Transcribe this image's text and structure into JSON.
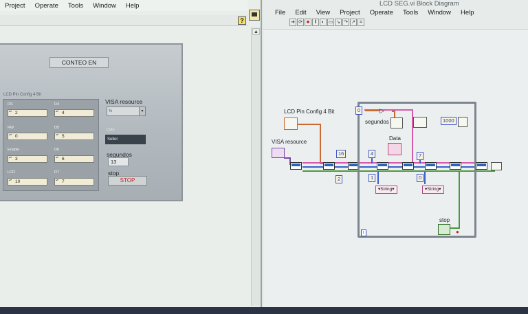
{
  "front_panel": {
    "menu": [
      "Project",
      "Operate",
      "Tools",
      "Window",
      "Help"
    ],
    "help_button": "?",
    "title_box": "CONTEO EN",
    "cluster_label": "LCD Pin Config 4 Bit",
    "cluster_fields": [
      {
        "label": "RS",
        "value": "2"
      },
      {
        "label": "D4",
        "value": "4"
      },
      {
        "label": "RW",
        "value": "0"
      },
      {
        "label": "D5",
        "value": "5"
      },
      {
        "label": "Enable",
        "value": "3"
      },
      {
        "label": "D6",
        "value": "6"
      },
      {
        "label": "LCD",
        "value": "10"
      },
      {
        "label": "D7",
        "value": "7"
      }
    ],
    "visa_label": "VISA resource",
    "visa_value": "%",
    "data_label": "Data",
    "data_value": "Sellor",
    "segundos_label": "segundos",
    "segundos_value": "13",
    "stop_label": "stop",
    "stop_button": "STOP"
  },
  "block_diagram": {
    "title": "LCD SEG.vi Block Diagram",
    "menu": [
      "File",
      "Edit",
      "View",
      "Project",
      "Operate",
      "Tools",
      "Window",
      "Help"
    ],
    "labels": {
      "lcd_pin": "LCD Pin Config 4 Bit",
      "visa": "VISA resource",
      "segundos": "segundos",
      "data": "Data",
      "stop": "stop"
    },
    "constants": {
      "c16": "16",
      "c2": "2",
      "c4": "4",
      "c1": "1",
      "c7": "7",
      "c0_inner": "0",
      "c0_shift": "0",
      "c1000": "1000"
    },
    "string_constants": [
      "String",
      "String"
    ],
    "loop_iteration": "i"
  },
  "colors": {
    "wire_orange": "#c86a32",
    "wire_pink": "#d65aa8",
    "wire_blue": "#3a5fc8",
    "wire_green": "#4a9a3a",
    "loop_border": "#7c8590",
    "stop_text": "#d1202a"
  }
}
